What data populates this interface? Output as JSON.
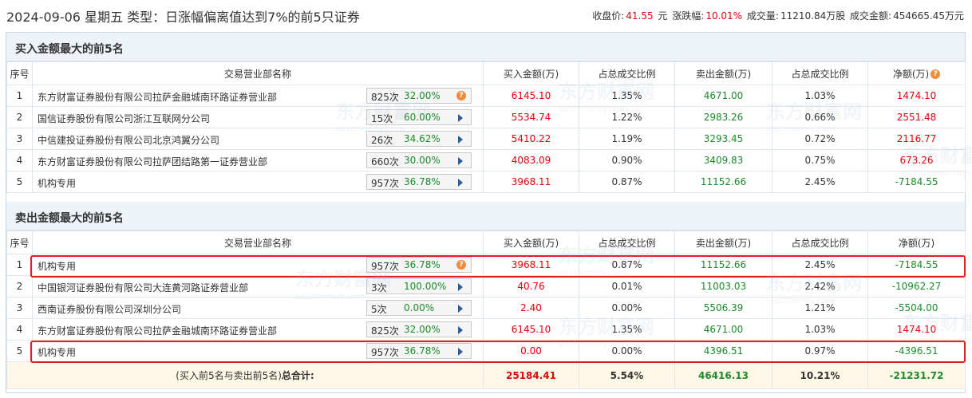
{
  "header": {
    "title": "2024-09-06 星期五 类型：日涨幅偏离值达到7%的前5只证券",
    "close_label": "收盘价:",
    "close_value": "41.55",
    "close_unit": "元",
    "change_label": "涨跌幅:",
    "change_value": "10.01%",
    "volume_label": "成交量:",
    "volume_value": "11210.84万股",
    "amount_label": "成交金额:",
    "amount_value": "454665.45万元"
  },
  "columns": {
    "seq": "序号",
    "name": "交易营业部名称",
    "buy": "买入金额(万)",
    "buy_ratio": "占总成交比例",
    "sell": "卖出金额(万)",
    "sell_ratio": "占总成交比例",
    "net": "净额(万)"
  },
  "buy_section": {
    "title": "买入金额最大的前5名",
    "rows": [
      {
        "seq": "1",
        "name": "东方财富证券股份有限公司拉萨金融城南环路证券营业部",
        "count": "825次",
        "pct": "32.00%",
        "buy": "6145.10",
        "buy_ratio": "1.35%",
        "sell": "4671.00",
        "sell_ratio": "1.03%",
        "net": "1474.10",
        "net_color": "red",
        "icon": "question"
      },
      {
        "seq": "2",
        "name": "国信证券股份有限公司浙江互联网分公司",
        "count": "15次",
        "pct": "60.00%",
        "buy": "5534.74",
        "buy_ratio": "1.22%",
        "sell": "2983.26",
        "sell_ratio": "0.66%",
        "net": "2551.48",
        "net_color": "red",
        "icon": "arrow"
      },
      {
        "seq": "3",
        "name": "中信建投证券股份有限公司北京鸿翼分公司",
        "count": "26次",
        "pct": "34.62%",
        "buy": "5410.22",
        "buy_ratio": "1.19%",
        "sell": "3293.45",
        "sell_ratio": "0.72%",
        "net": "2116.77",
        "net_color": "red",
        "icon": "arrow"
      },
      {
        "seq": "4",
        "name": "东方财富证券股份有限公司拉萨团结路第一证券营业部",
        "count": "660次",
        "pct": "30.00%",
        "buy": "4083.09",
        "buy_ratio": "0.90%",
        "sell": "3409.83",
        "sell_ratio": "0.75%",
        "net": "673.26",
        "net_color": "red",
        "icon": "arrow"
      },
      {
        "seq": "5",
        "name": "机构专用",
        "count": "957次",
        "pct": "36.78%",
        "buy": "3968.11",
        "buy_ratio": "0.87%",
        "sell": "11152.66",
        "sell_ratio": "2.45%",
        "net": "-7184.55",
        "net_color": "green",
        "icon": "arrow"
      }
    ]
  },
  "sell_section": {
    "title": "卖出金额最大的前5名",
    "rows": [
      {
        "seq": "1",
        "name": "机构专用",
        "count": "957次",
        "pct": "36.78%",
        "buy": "3968.11",
        "buy_ratio": "0.87%",
        "sell": "11152.66",
        "sell_ratio": "2.45%",
        "net": "-7184.55",
        "net_color": "green",
        "icon": "question"
      },
      {
        "seq": "2",
        "name": "中国银河证券股份有限公司大连黄河路证券营业部",
        "count": "3次",
        "pct": "100.00%",
        "buy": "40.76",
        "buy_ratio": "0.01%",
        "sell": "11003.03",
        "sell_ratio": "2.42%",
        "net": "-10962.27",
        "net_color": "green",
        "icon": "arrow"
      },
      {
        "seq": "3",
        "name": "西南证券股份有限公司深圳分公司",
        "count": "5次",
        "pct": "0.00%",
        "buy": "2.40",
        "buy_ratio": "0.00%",
        "sell": "5506.39",
        "sell_ratio": "1.21%",
        "net": "-5504.00",
        "net_color": "green",
        "icon": "arrow"
      },
      {
        "seq": "4",
        "name": "东方财富证券股份有限公司拉萨金融城南环路证券营业部",
        "count": "825次",
        "pct": "32.00%",
        "buy": "6145.10",
        "buy_ratio": "1.35%",
        "sell": "4671.00",
        "sell_ratio": "1.03%",
        "net": "1474.10",
        "net_color": "red",
        "icon": "arrow"
      },
      {
        "seq": "5",
        "name": "机构专用",
        "count": "957次",
        "pct": "36.78%",
        "buy": "0.00",
        "buy_ratio": "0.00%",
        "sell": "4396.51",
        "sell_ratio": "0.97%",
        "net": "-4396.51",
        "net_color": "green",
        "icon": "arrow"
      }
    ]
  },
  "total": {
    "label_prefix": "(买入前5名与卖出前5名)",
    "label_bold": "总合计:",
    "buy": "25184.41",
    "buy_ratio": "5.54%",
    "sell": "46416.13",
    "sell_ratio": "10.21%",
    "net": "-21231.72"
  },
  "watermark": {
    "cn": "东方财富网",
    "en": "eastmoney.com"
  },
  "colors": {
    "up": "#e3000e",
    "down": "#1e8a2e",
    "highlight": "#e02020",
    "header_bg": "#eef3f9"
  }
}
